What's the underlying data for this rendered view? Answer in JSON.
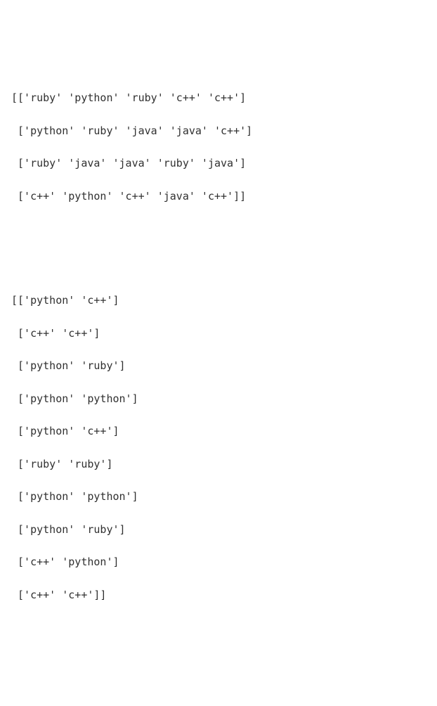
{
  "arrays": [
    {
      "rows": [
        [
          "ruby",
          "python",
          "ruby",
          "c++",
          "c++"
        ],
        [
          "python",
          "ruby",
          "java",
          "java",
          "c++"
        ],
        [
          "ruby",
          "java",
          "java",
          "ruby",
          "java"
        ],
        [
          "c++",
          "python",
          "c++",
          "java",
          "c++"
        ]
      ]
    },
    {
      "rows": [
        [
          "python",
          "c++"
        ],
        [
          "c++",
          "c++"
        ],
        [
          "python",
          "ruby"
        ],
        [
          "python",
          "python"
        ],
        [
          "python",
          "c++"
        ],
        [
          "ruby",
          "ruby"
        ],
        [
          "python",
          "python"
        ],
        [
          "python",
          "ruby"
        ],
        [
          "c++",
          "python"
        ],
        [
          "c++",
          "c++"
        ]
      ]
    }
  ]
}
